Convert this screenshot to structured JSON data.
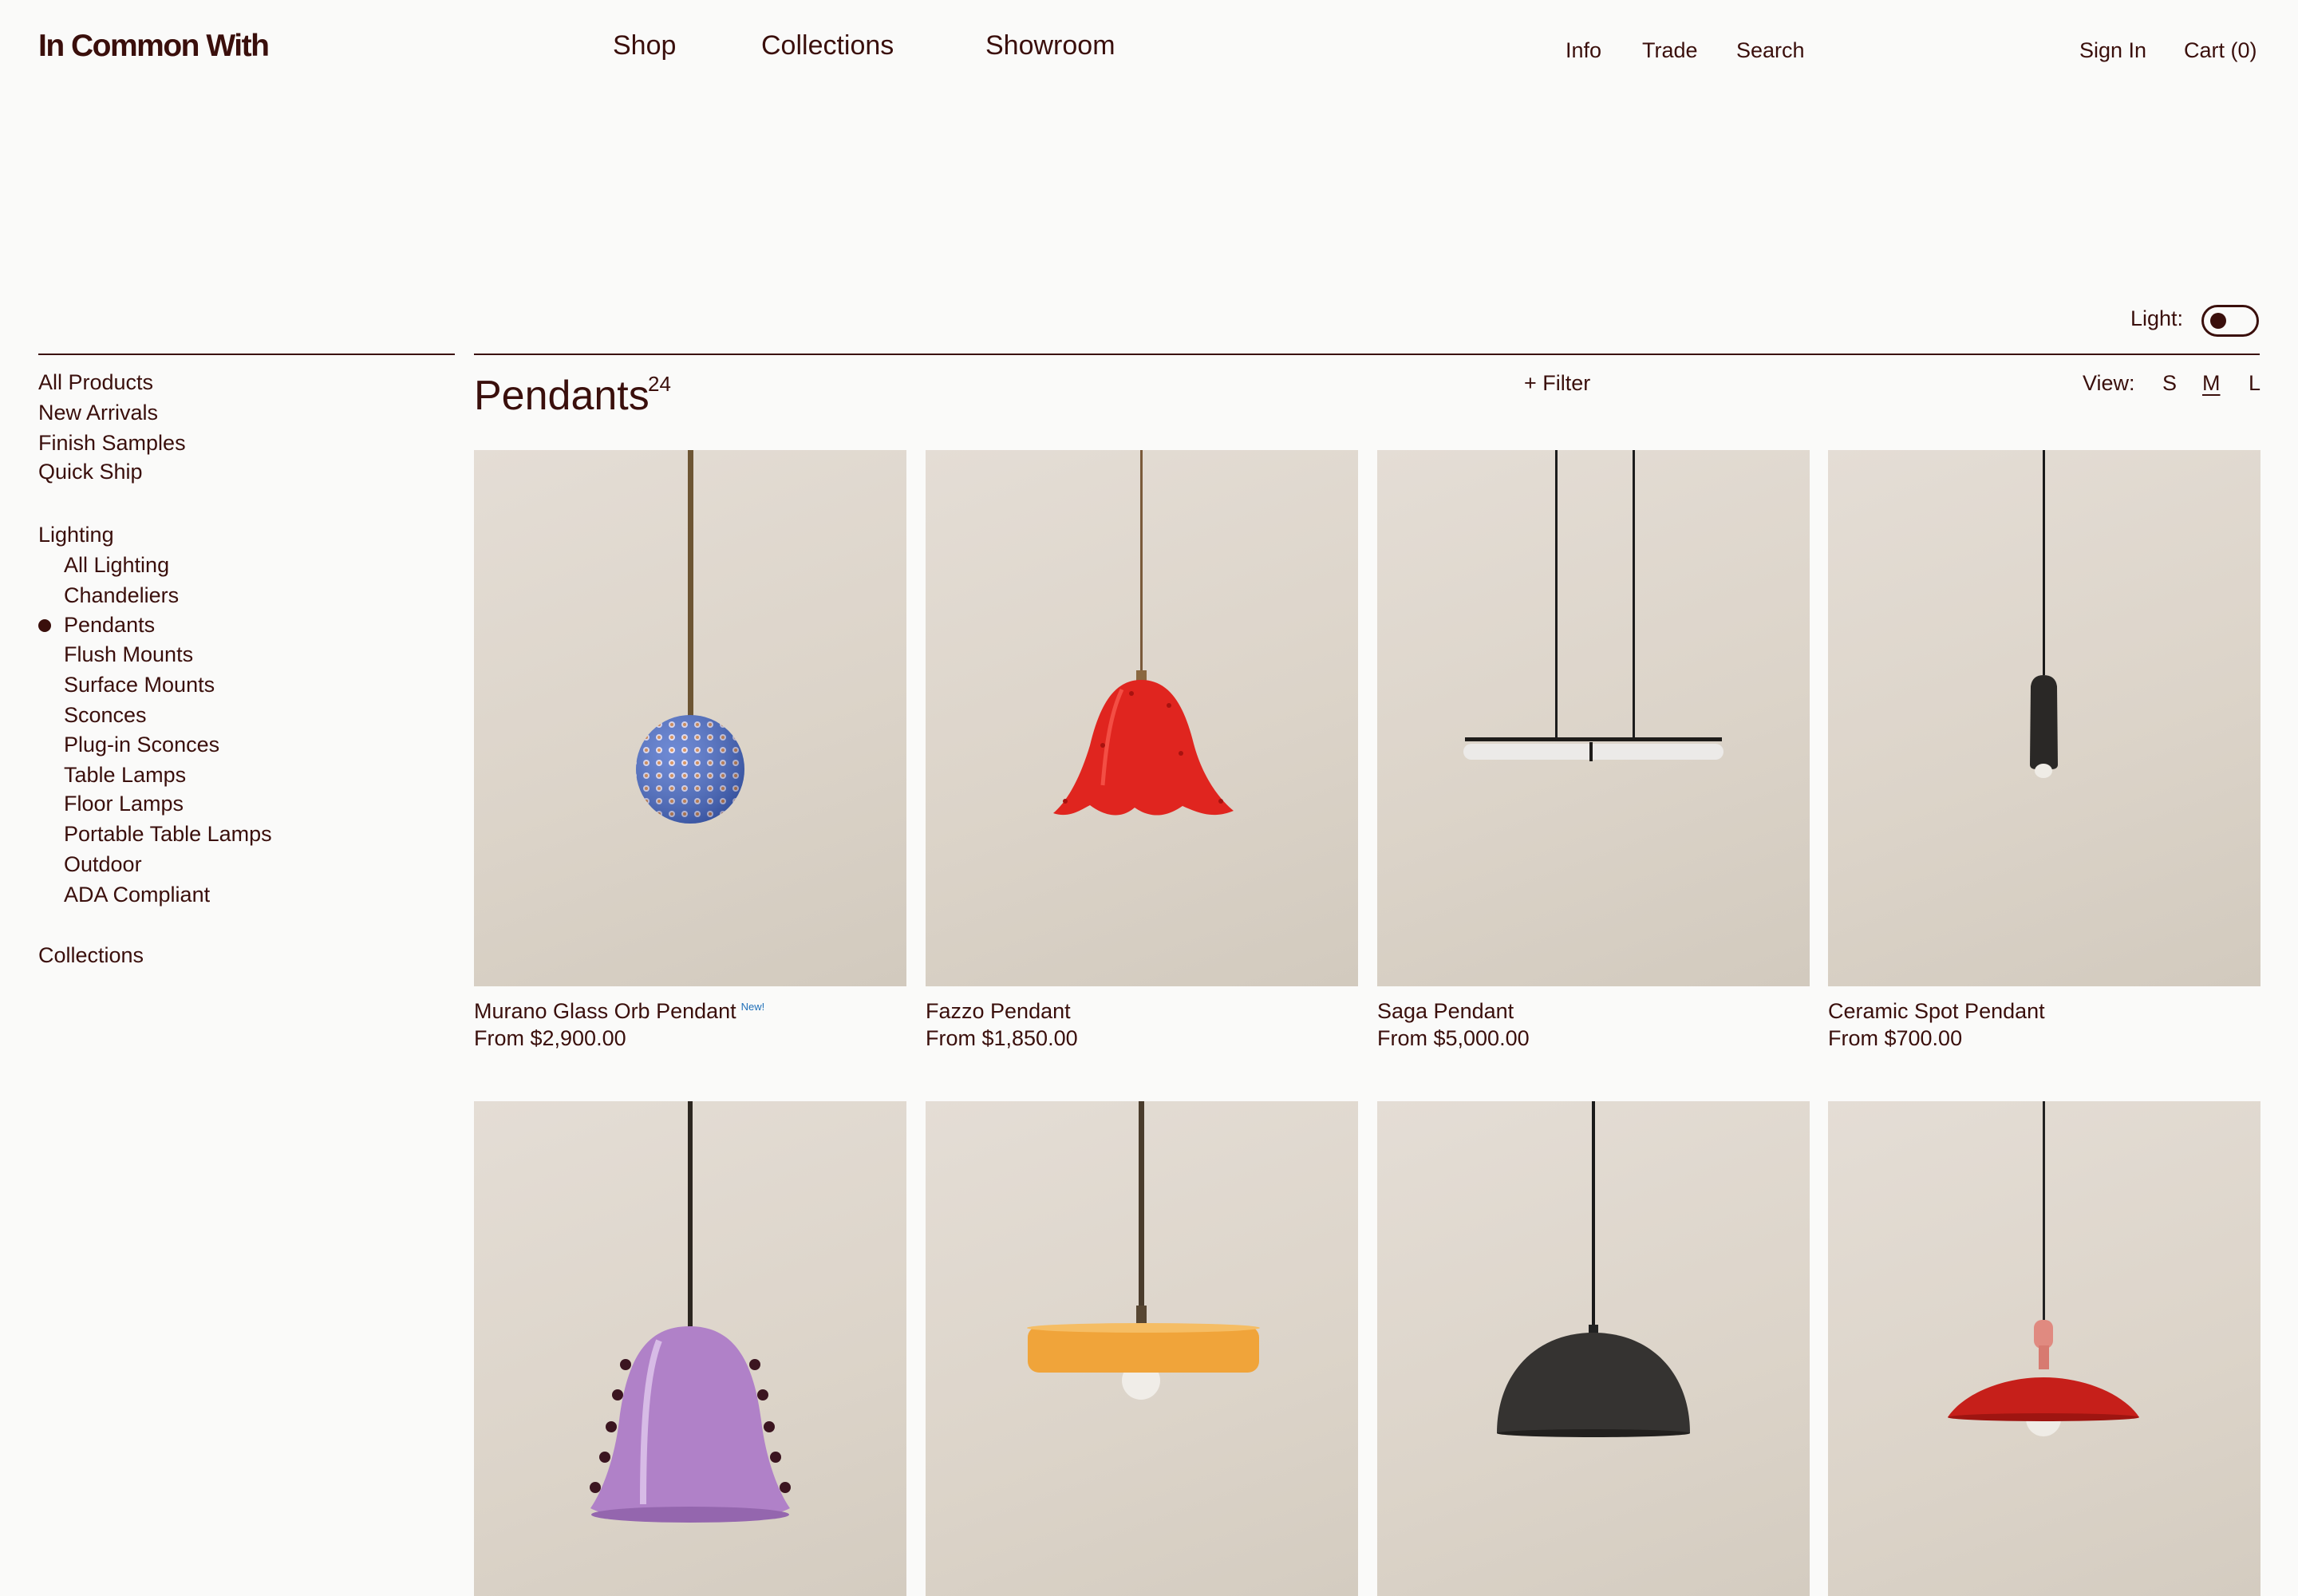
{
  "brand": {
    "logo": "In Common With"
  },
  "nav": {
    "main": [
      "Shop",
      "Collections",
      "Showroom"
    ],
    "util": [
      "Info",
      "Trade",
      "Search"
    ],
    "sign_in": "Sign In",
    "cart": "Cart (0)"
  },
  "light_toggle": {
    "label": "Light:"
  },
  "sidebar": {
    "top": [
      "All Products",
      "New Arrivals",
      "Finish Samples",
      "Quick Ship"
    ],
    "lighting_heading": "Lighting",
    "lighting_items": [
      "All Lighting",
      "Chandeliers",
      "Pendants",
      "Flush Mounts",
      "Surface Mounts",
      "Sconces",
      "Plug-in Sconces",
      "Table Lamps",
      "Floor Lamps",
      "Portable Table Lamps",
      "Outdoor",
      "ADA Compliant"
    ],
    "active_item": "Pendants",
    "collections": "Collections"
  },
  "listing": {
    "title": "Pendants",
    "count": "24",
    "filter": "+ Filter",
    "view_label": "View:",
    "view_options": [
      "S",
      "M",
      "L"
    ],
    "view_active": "M"
  },
  "products": [
    {
      "name": "Murano Glass Orb Pendant",
      "badge": "New!",
      "price": "From $2,900.00"
    },
    {
      "name": "Fazzo Pendant",
      "price": "From $1,850.00"
    },
    {
      "name": "Saga Pendant",
      "price": "From $5,000.00"
    },
    {
      "name": "Ceramic Spot Pendant",
      "price": "From $700.00"
    },
    {
      "name": "",
      "price": ""
    },
    {
      "name": "",
      "price": ""
    },
    {
      "name": "",
      "price": ""
    },
    {
      "name": "",
      "price": ""
    }
  ],
  "colors": {
    "brand_text": "#3a0f0c",
    "background": "#fafaf9",
    "badge": "#1f6fb8"
  }
}
